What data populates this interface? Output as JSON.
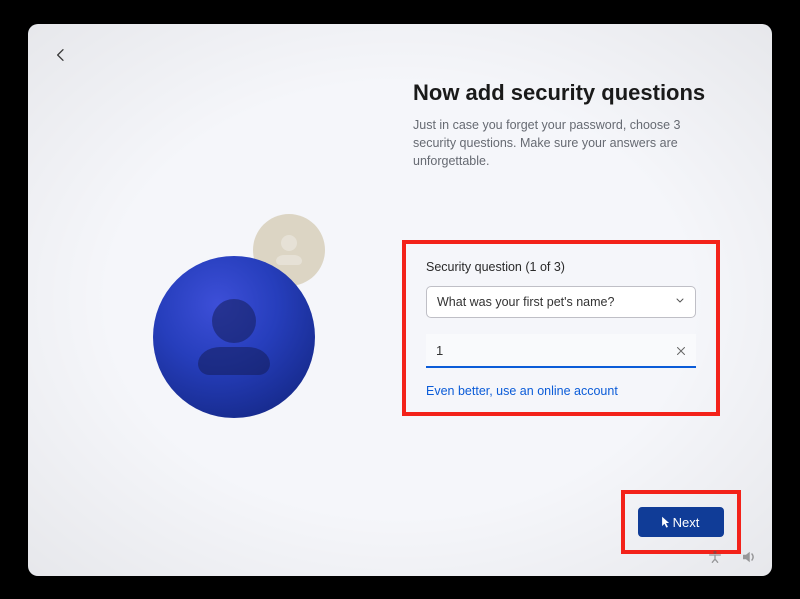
{
  "heading": {
    "title": "Now add security questions",
    "subtitle": "Just in case you forget your password, choose 3 security questions. Make sure your answers are unforgettable."
  },
  "form": {
    "section_label": "Security question (1 of 3)",
    "selected_question": "What was your first pet's name?",
    "answer_value": "1",
    "online_link": "Even better, use an online account"
  },
  "actions": {
    "next_label": "Next"
  },
  "colors": {
    "accent": "#0b5cd8",
    "callout": "#f3221a"
  }
}
